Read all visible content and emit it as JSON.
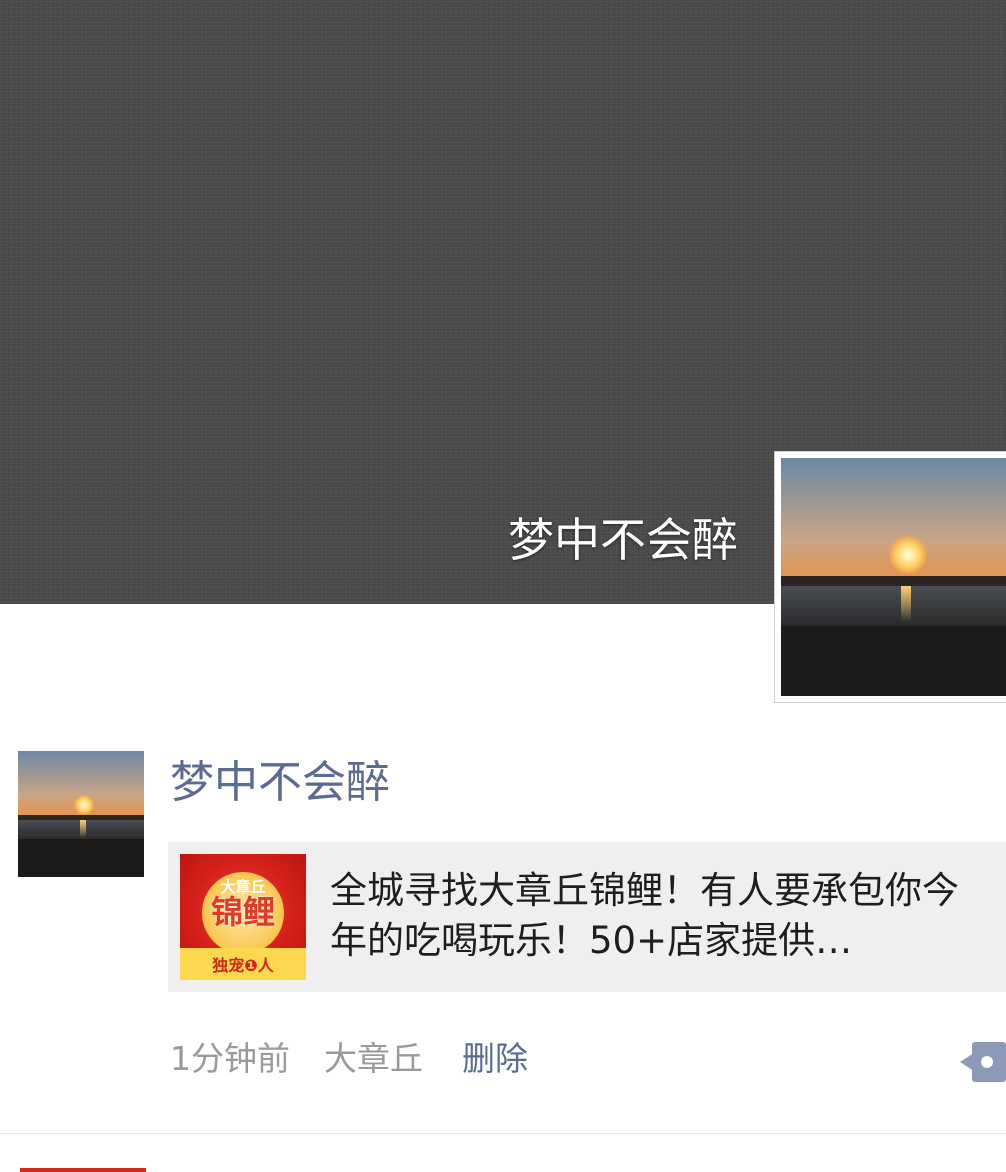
{
  "profile": {
    "cover_name": "梦中不会醉",
    "avatar_icon": "sunset-avatar-icon"
  },
  "post": {
    "author": "梦中不会醉",
    "avatar_icon": "sunset-avatar-icon",
    "link": {
      "title": "全城寻找大章丘锦鲤！有人要承包你今年的吃喝玩乐！50+店家提供…",
      "thumbnail": {
        "top_text": "大章丘",
        "main_text": "锦鲤",
        "bottom_text": "独宠❶人"
      }
    },
    "time": "1分钟前",
    "location": "大章丘",
    "delete_label": "删除",
    "action_icon": "comment-dots-icon"
  },
  "colors": {
    "link_blue": "#5b6b92",
    "meta_gray": "#9a9a9a",
    "card_bg": "#efefef",
    "cover_bg": "#4a4a4a"
  }
}
